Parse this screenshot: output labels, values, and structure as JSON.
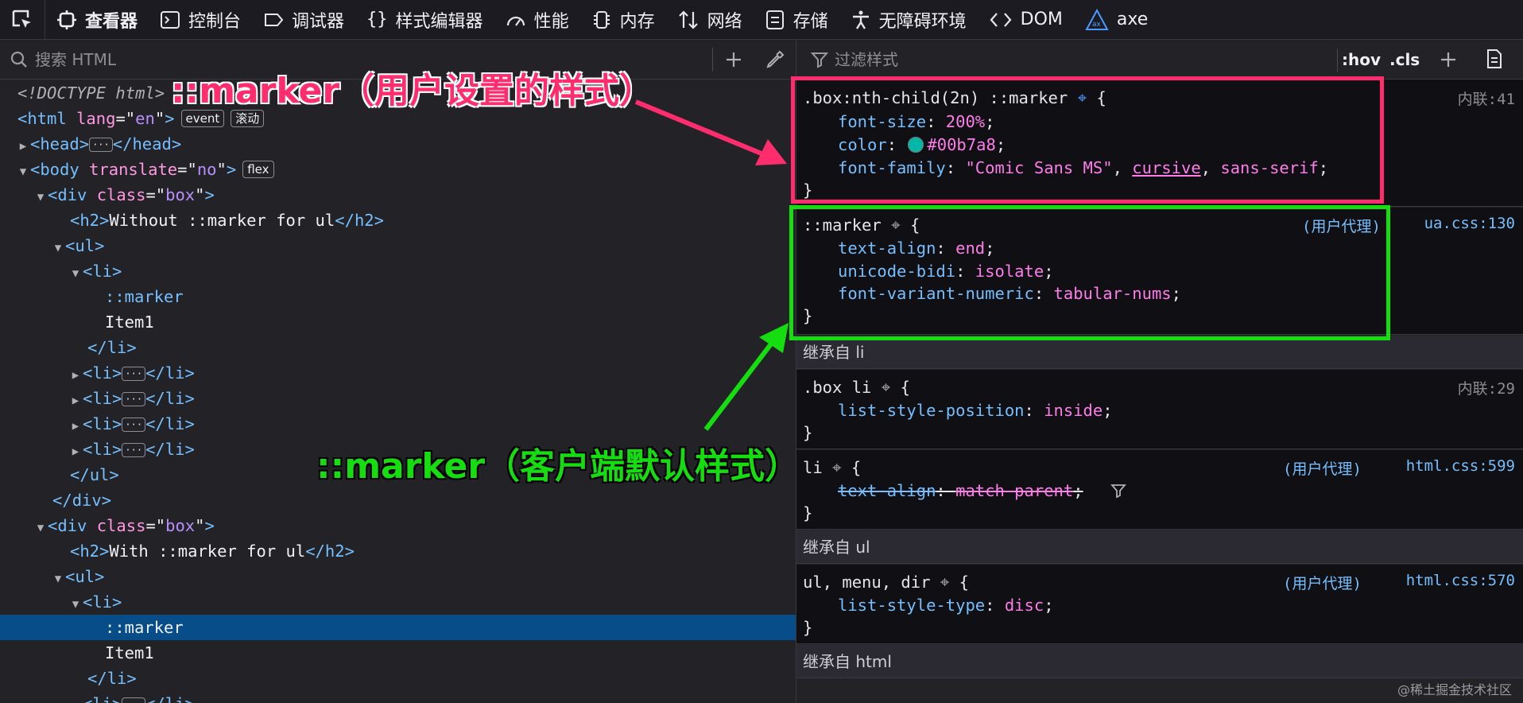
{
  "toolbar": {
    "tabs": [
      {
        "label": "查看器",
        "icon": "inspector-icon"
      },
      {
        "label": "控制台",
        "icon": "console-icon"
      },
      {
        "label": "调试器",
        "icon": "debugger-icon"
      },
      {
        "label": "样式编辑器",
        "icon": "style-editor-icon"
      },
      {
        "label": "性能",
        "icon": "performance-icon"
      },
      {
        "label": "内存",
        "icon": "memory-icon"
      },
      {
        "label": "网络",
        "icon": "network-icon"
      },
      {
        "label": "存储",
        "icon": "storage-icon"
      },
      {
        "label": "无障碍环境",
        "icon": "accessibility-icon"
      },
      {
        "label": "DOM",
        "icon": "dom-icon"
      },
      {
        "label": "axe",
        "icon": "axe-icon"
      }
    ]
  },
  "left": {
    "search_placeholder": "搜索 HTML",
    "tree": {
      "doctype": "<!DOCTYPE html>",
      "html_tag": "html",
      "lang_attr": "lang",
      "lang_val": "en",
      "badge_event": "event",
      "badge_scroll": "滚动",
      "head_tag": "head",
      "body_tag": "body",
      "translate_attr": "translate",
      "translate_val": "no",
      "badge_flex": "flex",
      "div_tag": "div",
      "class_attr": "class",
      "class_val": "box",
      "h2_tag": "h2",
      "h2_text_1": "Without ::marker for ul",
      "h2_text_2": "With ::marker for ul",
      "ul_tag": "ul",
      "li_tag": "li",
      "marker": "::marker",
      "item_text": "Item1",
      "dots": "···"
    }
  },
  "right": {
    "filter_placeholder": "过滤样式",
    "hov": ":hov",
    "cls": ".cls",
    "rules": {
      "r1_selector": ".box:nth-child(2n) ::marker",
      "r1_source": "内联:41",
      "r1_p1": "font-size",
      "r1_v1": "200%",
      "r1_p2": "color",
      "r1_v2": "#00b7a8",
      "r1_p3": "font-family",
      "r1_v3a": "\"Comic Sans MS\"",
      "r1_v3b": "cursive",
      "r1_v3c": "sans-serif",
      "r2_selector": "::marker",
      "r2_ua": "(用户代理)",
      "r2_source": "ua.css:130",
      "r2_p1": "text-align",
      "r2_v1": "end",
      "r2_p2": "unicode-bidi",
      "r2_v2": "isolate",
      "r2_p3": "font-variant-numeric",
      "r2_v3": "tabular-nums",
      "inh_li": "继承自 li",
      "r3_selector": ".box li",
      "r3_source": "内联:29",
      "r3_p1": "list-style-position",
      "r3_v1": "inside",
      "r4_selector": "li",
      "r4_ua": "(用户代理)",
      "r4_source": "html.css:599",
      "r4_p1": "text-align",
      "r4_v1": "match-parent",
      "inh_ul": "继承自 ul",
      "r5_selector": "ul, menu, dir",
      "r5_ua": "(用户代理)",
      "r5_source": "html.css:570",
      "r5_p1": "list-style-type",
      "r5_v1": "disc",
      "inh_html": "继承自 html"
    }
  },
  "annotations": {
    "pink_label": "::marker（用户设置的样式）",
    "green_label": "::marker（客户端默认样式）",
    "pink_color": "#ff2d6e",
    "green_color": "#16dd10"
  },
  "watermark": "@稀土掘金技术社区",
  "colors": {
    "selection": "#074d8a",
    "swatch": "#00b7a8"
  }
}
